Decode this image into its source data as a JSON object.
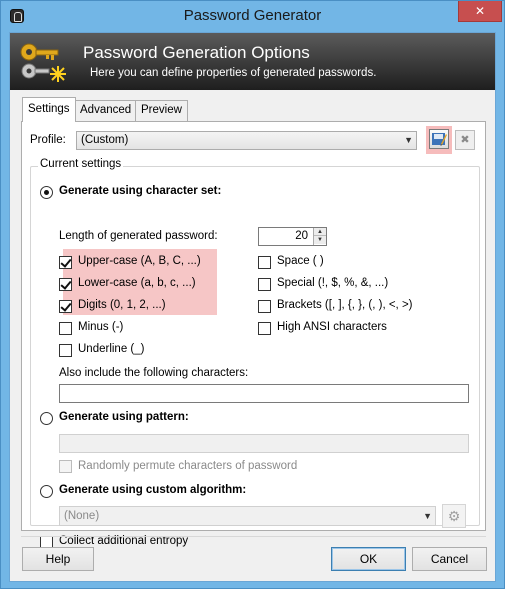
{
  "window": {
    "title": "Password Generator",
    "close_glyph": "✕"
  },
  "banner": {
    "title": "Password Generation Options",
    "subtitle": "Here you can define properties of generated passwords.",
    "icon": "keys-icon"
  },
  "tabs": [
    {
      "label": "Settings",
      "active": true
    },
    {
      "label": "Advanced",
      "active": false
    },
    {
      "label": "Preview",
      "active": false
    }
  ],
  "profile": {
    "label": "Profile:",
    "value": "(Custom)",
    "delete_glyph": "✖"
  },
  "current_settings": {
    "title": "Current settings",
    "charset_option": {
      "label": "Generate using character set:",
      "selected": true
    },
    "length": {
      "label": "Length of generated password:",
      "value": "20"
    },
    "checkboxes_left": [
      {
        "label": "Upper-case (A, B, C, ...)",
        "checked": true
      },
      {
        "label": "Lower-case (a, b, c, ...)",
        "checked": true
      },
      {
        "label": "Digits (0, 1, 2, ...)",
        "checked": true
      },
      {
        "label": "Minus (-)",
        "checked": false
      },
      {
        "label": "Underline (_)",
        "checked": false
      }
    ],
    "checkboxes_right": [
      {
        "label": "Space ( )",
        "checked": false
      },
      {
        "label": "Special (!, $, %, &, ...)",
        "checked": false
      },
      {
        "label": "Brackets ([, ], {, }, (, ), <, >)",
        "checked": false
      },
      {
        "label": "High ANSI characters",
        "checked": false
      }
    ],
    "also_include": {
      "label": "Also include the following characters:",
      "value": ""
    },
    "pattern_option": {
      "label": "Generate using pattern:",
      "selected": false
    },
    "permute": {
      "label": "Randomly permute characters of password",
      "checked": false
    },
    "custom_option": {
      "label": "Generate using custom algorithm:",
      "selected": false
    },
    "custom_algorithm": {
      "value": "(None)"
    },
    "entropy": {
      "label": "Collect additional entropy",
      "checked": false
    }
  },
  "buttons": {
    "help": "Help",
    "ok": "OK",
    "cancel": "Cancel"
  },
  "colors": {
    "highlight": "#f6c6c6",
    "titlebar": "#72b6e6",
    "close": "#c74f4f"
  }
}
